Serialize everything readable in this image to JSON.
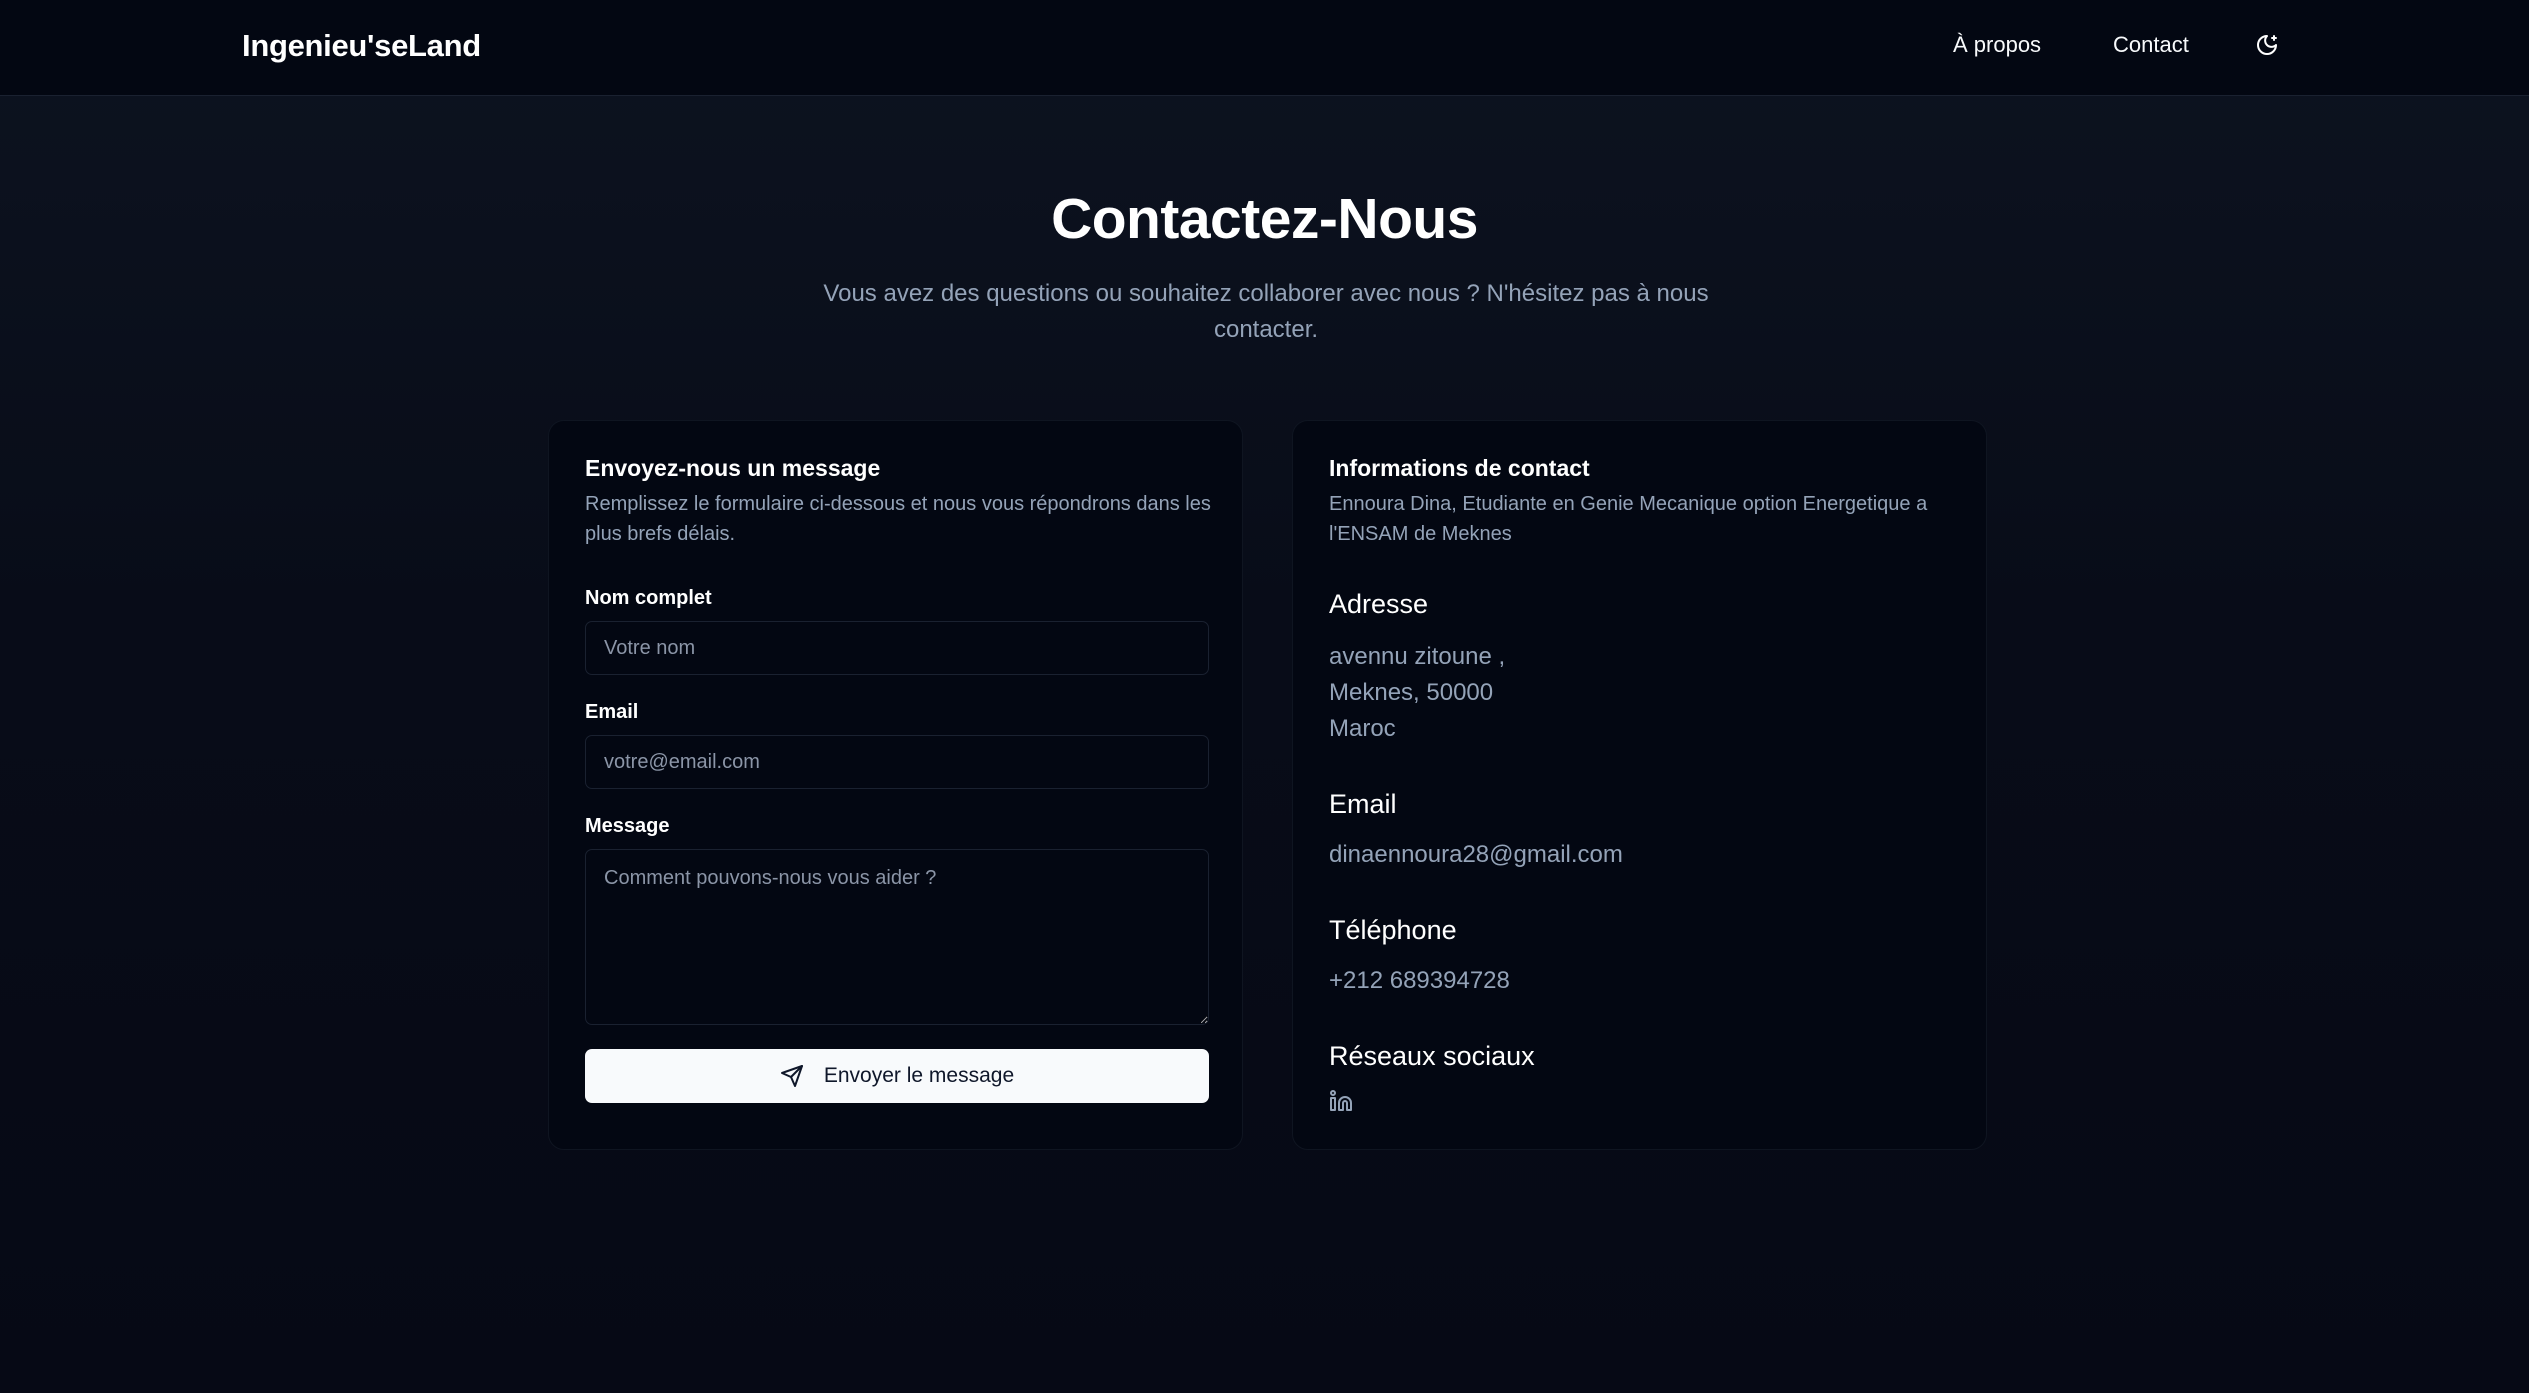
{
  "navbar": {
    "brand": "Ingenieu'seLand",
    "links": [
      "À propos",
      "Contact"
    ],
    "theme_toggle_icon": "moon-icon"
  },
  "hero": {
    "title": "Contactez-Nous",
    "subtitle_line1": "Vous avez des questions ou souhaitez collaborer avec nous ? N'hésitez pas à nous",
    "subtitle_line2": "contacter."
  },
  "form_card": {
    "title": "Envoyez-nous un message",
    "description": "Remplissez le formulaire ci-dessous et nous vous répondrons dans les plus brefs délais.",
    "fields": {
      "name": {
        "label": "Nom complet",
        "placeholder": "Votre nom",
        "value": ""
      },
      "email": {
        "label": "Email",
        "placeholder": "votre@email.com",
        "value": ""
      },
      "message": {
        "label": "Message",
        "placeholder": "Comment pouvons-nous vous aider ?",
        "value": ""
      }
    },
    "submit_label": "Envoyer le message",
    "submit_icon": "send-icon"
  },
  "info_card": {
    "title": "Informations de contact",
    "description": "Ennoura Dina, Etudiante en Genie Mecanique option Energetique a l'ENSAM de Meknes",
    "address": {
      "heading": "Adresse",
      "line1": "avennu zitoune ,",
      "line2": "Meknes, 50000",
      "line3": "Maroc"
    },
    "email": {
      "heading": "Email",
      "value": "dinaennoura28@gmail.com"
    },
    "phone": {
      "heading": "Téléphone",
      "value": "+212 689394728"
    },
    "social": {
      "heading": "Réseaux sociaux",
      "icons": [
        "linkedin-icon"
      ]
    }
  },
  "colors": {
    "background": "#0b101c",
    "card": "#030712",
    "muted_text": "#94a3b8",
    "button_bg": "#f8fafc",
    "button_text": "#0f172a"
  }
}
